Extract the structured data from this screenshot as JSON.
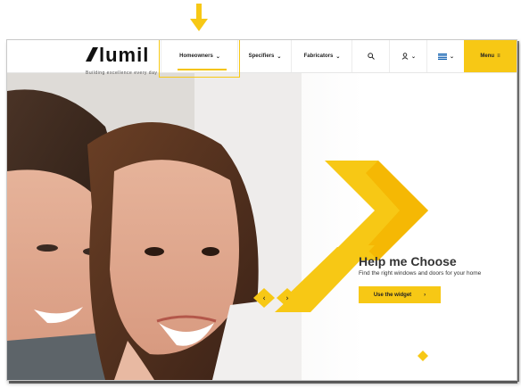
{
  "logo": {
    "text": "lumil",
    "tagline": "Building excellence every day"
  },
  "nav": {
    "items": [
      {
        "label": "Homeowners"
      },
      {
        "label": "Specifiers"
      },
      {
        "label": "Fabricators"
      }
    ],
    "menu_label": "Menu"
  },
  "hero": {
    "title": "Help me Choose",
    "subtitle": "Find the right windows and doors for your home",
    "cta_label": "Use the widget"
  },
  "colors": {
    "accent": "#f7c815",
    "accent_dark": "#f4b400"
  }
}
